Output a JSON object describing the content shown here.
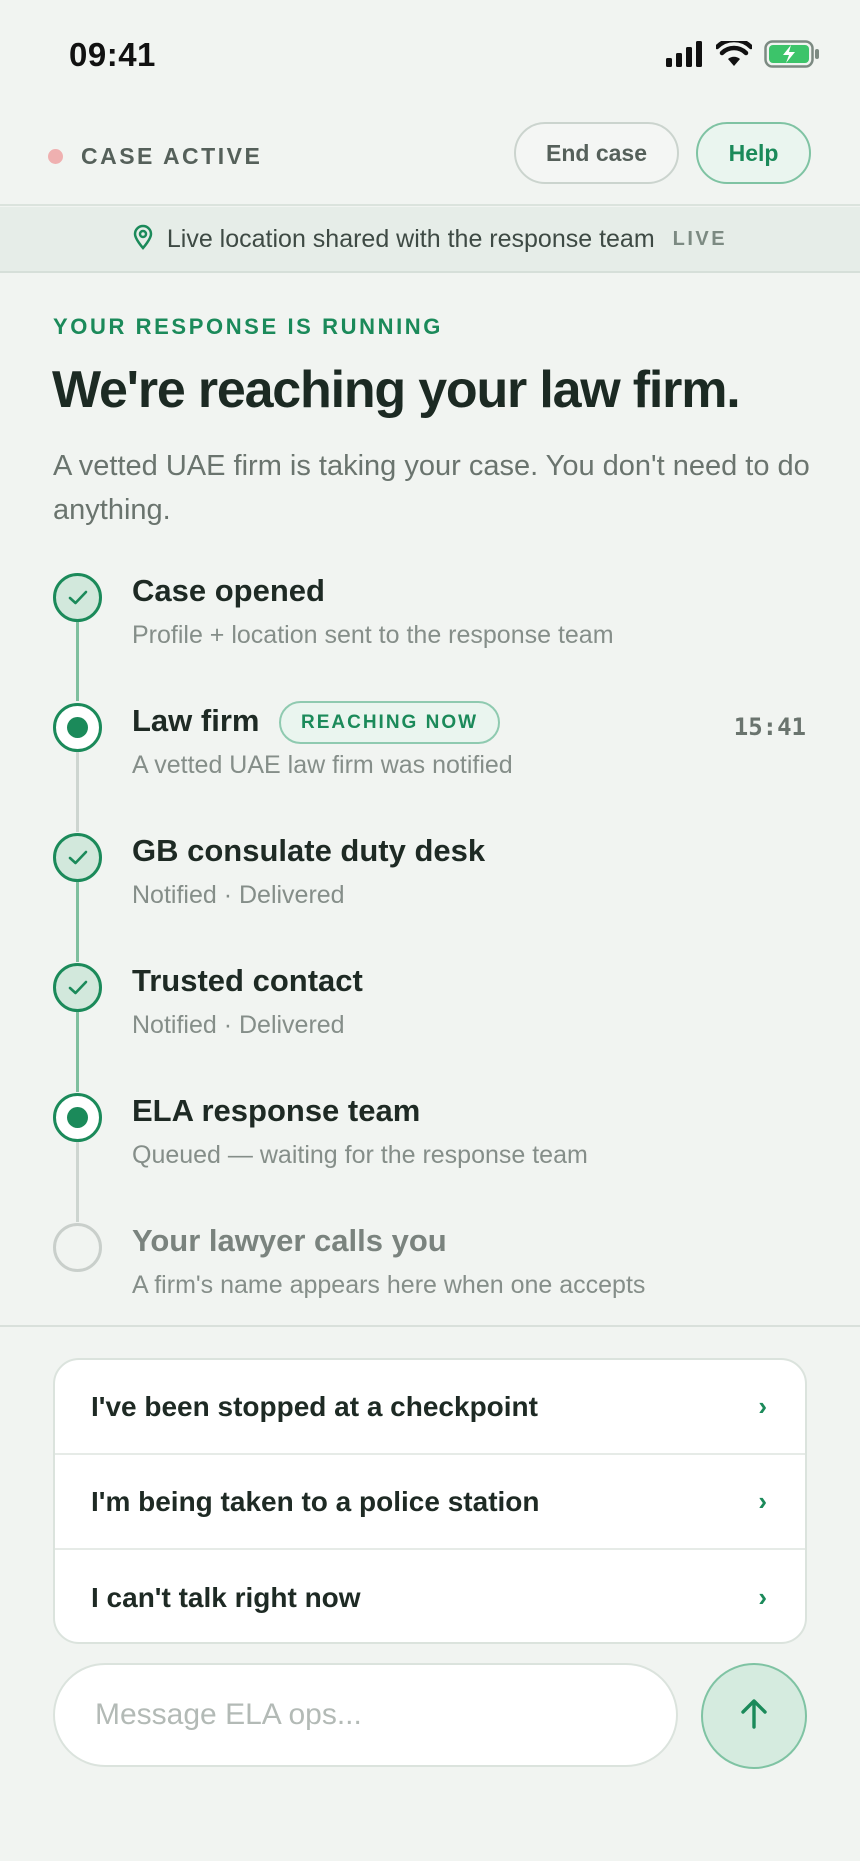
{
  "status_bar": {
    "time": "09:41",
    "icons": [
      "signal-icon",
      "wifi-icon",
      "battery-charging-icon"
    ]
  },
  "top_bar": {
    "case_status": "CASE ACTIVE",
    "end_case_label": "End case",
    "help_label": "Help"
  },
  "location_banner": {
    "text": "Live location shared with the response team",
    "live_label": "LIVE",
    "icon": "location-pin-icon"
  },
  "heading": {
    "eyebrow": "YOUR RESPONSE IS RUNNING",
    "title": "We're reaching your law firm.",
    "description": "A vetted UAE firm is taking your case. You don't need to do anything."
  },
  "timeline": [
    {
      "title": "Case opened",
      "subtitle": "Profile + location sent to the response team",
      "state": "done"
    },
    {
      "title": "Law firm",
      "subtitle": "A vetted UAE law firm was notified",
      "state": "active",
      "badge": "REACHING NOW",
      "time": "15:41"
    },
    {
      "title": "GB consulate duty desk",
      "subtitle": "Notified · Delivered",
      "state": "done"
    },
    {
      "title": "Trusted contact",
      "subtitle": "Notified · Delivered",
      "state": "done"
    },
    {
      "title": "ELA response team",
      "subtitle": "Queued — waiting for the response team",
      "state": "active"
    },
    {
      "title": "Your lawyer calls you",
      "subtitle": "A firm's name appears here when one accepts",
      "state": "pending"
    }
  ],
  "quick_replies": [
    {
      "label": "I've been stopped at a checkpoint"
    },
    {
      "label": "I'm being taken to a police station"
    },
    {
      "label": "I can't talk right now"
    }
  ],
  "composer": {
    "value": "",
    "placeholder": "Message ELA ops...",
    "send_icon": "arrow-up-icon"
  },
  "colors": {
    "accent": "#1b8a5a",
    "background": "#f1f4f1",
    "case_dot": "#efb0b0"
  }
}
